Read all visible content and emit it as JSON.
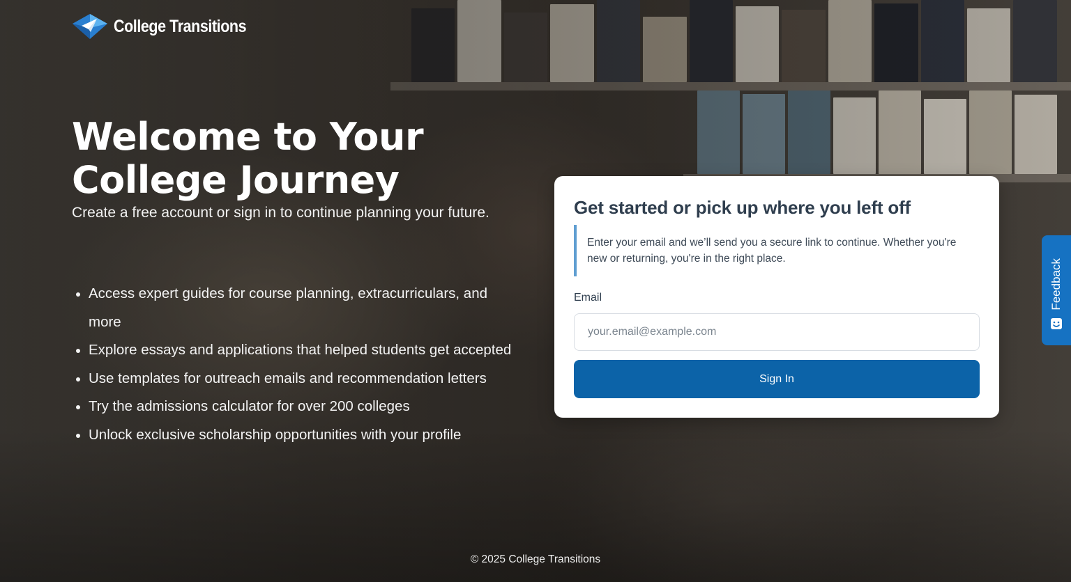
{
  "brand": {
    "name": "College Transitions",
    "logo_icon": "paper-plane-logo-icon",
    "accent_color": "#0c63a8"
  },
  "hero": {
    "title": "Welcome to Your College Journey",
    "subtitle": "Create a free account or sign in to continue planning your future.",
    "features": [
      "Access expert guides for course planning, extracurriculars, and more",
      "Explore essays and applications that helped students get accepted",
      "Use templates for outreach emails and recommendation letters",
      "Try the admissions calculator for over 200 colleges",
      "Unlock exclusive scholarship opportunities with your profile"
    ]
  },
  "signin": {
    "title": "Get started or pick up where you left off",
    "note": "Enter your email and we’ll send you a secure link to continue. Whether you're new or returning, you're in the right place.",
    "email_label": "Email",
    "email_placeholder": "your.email@example.com",
    "email_value": "",
    "button_label": "Sign In"
  },
  "feedback": {
    "label": "Feedback",
    "icon": "smiley-icon",
    "color": "#1672c2"
  },
  "footer": {
    "copyright": "© 2025 College Transitions"
  }
}
